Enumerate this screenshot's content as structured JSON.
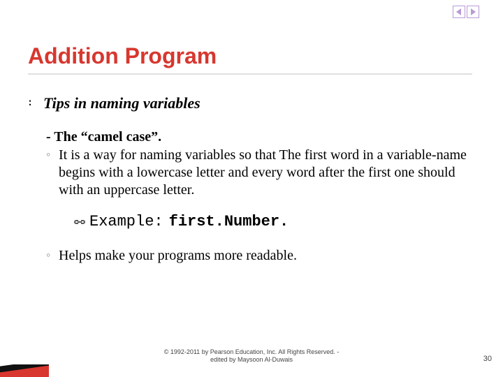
{
  "title": "Addition Program",
  "subtitle": "Tips in naming variables",
  "camel_heading": "- The “camel case”.",
  "explanation": "It is a way for naming variables so that The first word in a variable-name begins with a lowercase letter and every word after the first one should with an uppercase letter.",
  "example_label": "Example:",
  "example_value": "first.Number.",
  "readable": "Helps make your programs more readable.",
  "copyright_line1": "© 1992-2011 by Pearson Education, Inc. All Rights Reserved. -",
  "copyright_line2": "edited by Maysoon Al-Duwais",
  "page_number": "30"
}
